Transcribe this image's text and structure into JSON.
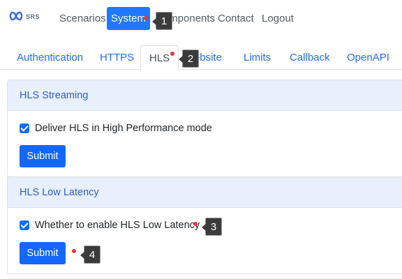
{
  "navbar": {
    "logo_text": "SRS",
    "links": [
      "Scenarios",
      "System",
      "Components",
      "Contact",
      "Logout"
    ]
  },
  "tabs": [
    "Authentication",
    "HTTPS",
    "HLS",
    "Website",
    "Limits",
    "Callback",
    "OpenAPI"
  ],
  "hls_streaming": {
    "title": "HLS Streaming",
    "checkbox_label": "Deliver HLS in High Performance mode",
    "checked": true,
    "submit_label": "Submit"
  },
  "hls_low_latency": {
    "title": "HLS Low Latency",
    "checkbox_label": "Whether to enable HLS Low Latency",
    "checked": true,
    "submit_label": "Submit"
  },
  "markers": [
    "1",
    "2",
    "3",
    "4"
  ],
  "colors": {
    "primary": "#1467f8",
    "card_header_bg": "#e8f0fe",
    "marker_dot": "#e53935",
    "marker_bg": "#3b3b3b"
  }
}
